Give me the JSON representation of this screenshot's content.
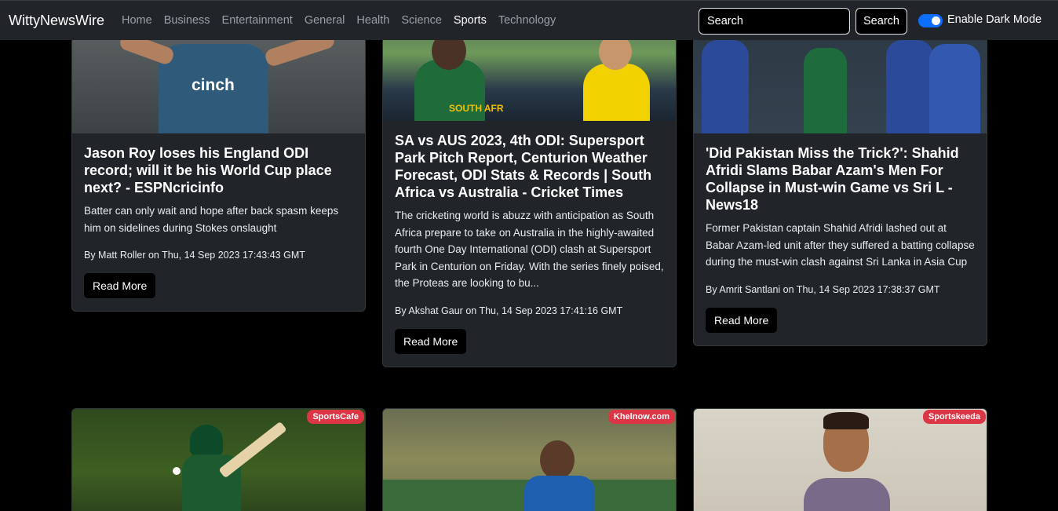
{
  "navbar": {
    "brand": "WittyNewsWire",
    "links": [
      "Home",
      "Business",
      "Entertainment",
      "General",
      "Health",
      "Science",
      "Sports",
      "Technology"
    ],
    "active_link": "Sports",
    "search_placeholder": "Search",
    "search_button": "Search",
    "dark_mode_label": "Enable Dark Mode",
    "dark_mode_on": true
  },
  "articles": [
    {
      "title": "Jason Roy loses his England ODI record; will it be his World Cup place next? - ESPNcricinfo",
      "description": "Batter can only wait and hope after back spasm keeps him on sidelines during Stokes onslaught",
      "meta": "By Matt Roller on Thu, 14 Sep 2023 17:43:43 GMT",
      "button": "Read More"
    },
    {
      "title": "SA vs AUS 2023, 4th ODI: Supersport Park Pitch Report, Centurion Weather Forecast, ODI Stats & Records | South Africa vs Australia - Cricket Times",
      "description": "The cricketing world is abuzz with anticipation as South Africa prepare to take on Australia in the highly-awaited fourth One Day International (ODI) clash at Supersport Park in Centurion on Friday. With the series finely poised, the Proteas are looking to bu...",
      "meta": "By Akshat Gaur on Thu, 14 Sep 2023 17:41:16 GMT",
      "button": "Read More"
    },
    {
      "title": "'Did Pakistan Miss the Trick?': Shahid Afridi Slams Babar Azam's Men For Collapse in Must-win Game vs Sri L - News18",
      "description": "Former Pakistan captain Shahid Afridi lashed out at Babar Azam-led unit after they suffered a batting collapse during the must-win clash against Sri Lanka in Asia Cup",
      "meta": "By Amrit Santlani on Thu, 14 Sep 2023 17:38:37 GMT",
      "button": "Read More"
    },
    {
      "source": "SportsCafe"
    },
    {
      "source": "Khelnow.com"
    },
    {
      "source": "Sportskeeda"
    }
  ],
  "image_text": {
    "sponsor": "cinch",
    "jersey": "SOUTH AFR"
  },
  "colors": {
    "navbar_bg": "#212529",
    "card_bg": "#212529",
    "page_bg": "#000000",
    "badge": "#dc3545",
    "toggle": "#0d6efd"
  }
}
